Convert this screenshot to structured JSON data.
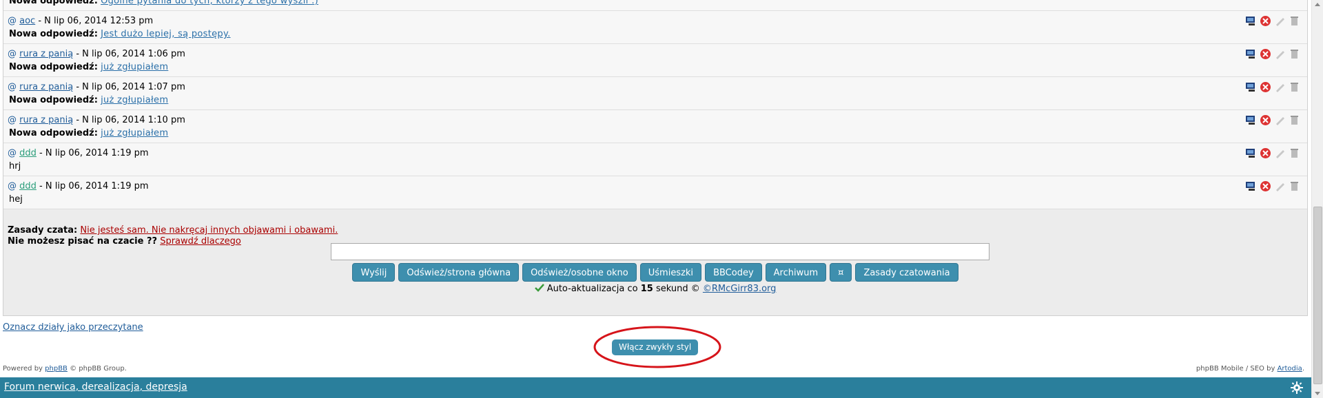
{
  "messages": [
    {
      "nick": "",
      "time": "",
      "label": "Nowa odpowiedź:",
      "text": "Ogólne pytania do tych, którzy z tego wyszli :)",
      "type": "reply",
      "nick_color": "blue"
    },
    {
      "nick": "aoc",
      "time": "- N lip 06, 2014 12:53 pm",
      "label": "Nowa odpowiedź:",
      "text": "Jest dużo lepiej, są postępy.",
      "type": "reply",
      "nick_color": "blue"
    },
    {
      "nick": "rura z panią",
      "time": "- N lip 06, 2014 1:06 pm",
      "label": "Nowa odpowiedź:",
      "text": "już zgłupiałem",
      "type": "reply",
      "nick_color": "blue"
    },
    {
      "nick": "rura z panią",
      "time": "- N lip 06, 2014 1:07 pm",
      "label": "Nowa odpowiedź:",
      "text": "już zgłupiałem",
      "type": "reply",
      "nick_color": "blue"
    },
    {
      "nick": "rura z panią",
      "time": "- N lip 06, 2014 1:10 pm",
      "label": "Nowa odpowiedź:",
      "text": "już zgłupiałem",
      "type": "reply",
      "nick_color": "blue"
    },
    {
      "nick": "ddd",
      "time": "- N lip 06, 2014 1:19 pm",
      "label": "",
      "text": "hrj",
      "type": "plain",
      "nick_color": "green"
    },
    {
      "nick": "ddd",
      "time": "- N lip 06, 2014 1:19 pm",
      "label": "",
      "text": "hej",
      "type": "plain",
      "nick_color": "green"
    }
  ],
  "at_symbol": "@",
  "rules": {
    "label": "Zasady czata:",
    "text": "Nie jesteś sam. Nie nakręcaj innych objawami i obawami.",
    "cannot_label": "Nie możesz pisać na czacie ??",
    "cannot_link": "Sprawdź dlaczego"
  },
  "buttons": [
    "Wyślij",
    "Odśwież/strona główna",
    "Odśwież/osobne okno",
    "Uśmieszki",
    "BBCodey",
    "Archiwum",
    "¤",
    "Zasady czatowania"
  ],
  "auto_update": {
    "prefix": "Auto-aktualizacja co",
    "seconds": "15",
    "suffix": "sekund ©",
    "credit": "©RMcGirr83.org"
  },
  "mark_read": "Oznacz działy jako przeczytane",
  "style_button": "Włącz zwykły styl",
  "powered": {
    "prefix": "Powered by",
    "link": "phpBB",
    "suffix": "© phpBB Group."
  },
  "mobile": {
    "prefix": "phpBB Mobile / SEO by",
    "link": "Artodia",
    "suffix": "."
  },
  "footer_title": "Forum nerwica, derealizacja, depresja",
  "colors": {
    "accent": "#3e8fae",
    "footer": "#2a7f9c",
    "highlight_circle": "#d6141a",
    "warning_link": "#aa0000"
  }
}
